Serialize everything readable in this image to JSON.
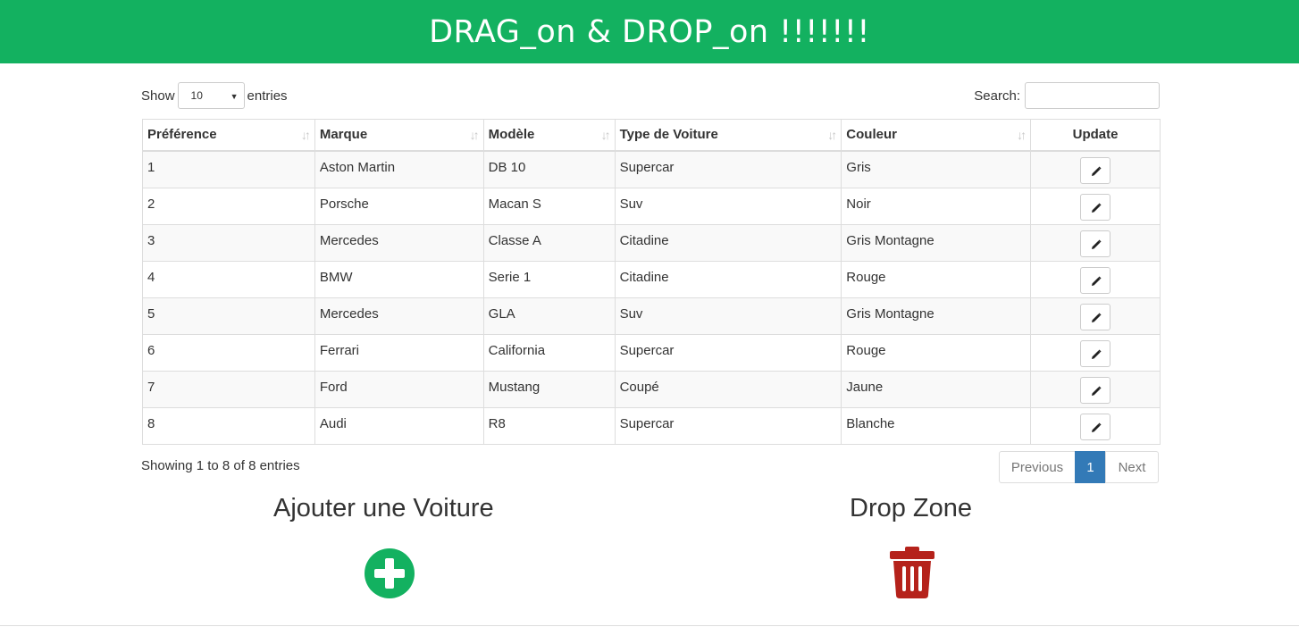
{
  "header": {
    "title": "DRAG_on & DROP_on !!!!!!!"
  },
  "length_menu": {
    "prefix": "Show",
    "value": "10",
    "suffix": "entries"
  },
  "search": {
    "label": "Search:",
    "value": ""
  },
  "table": {
    "columns": [
      "Préférence",
      "Marque",
      "Modèle",
      "Type de Voiture",
      "Couleur",
      "Update"
    ],
    "rows": [
      [
        "1",
        "Aston Martin",
        "DB 10",
        "Supercar",
        "Gris"
      ],
      [
        "2",
        "Porsche",
        "Macan S",
        "Suv",
        "Noir"
      ],
      [
        "3",
        "Mercedes",
        "Classe A",
        "Citadine",
        "Gris Montagne"
      ],
      [
        "4",
        "BMW",
        "Serie 1",
        "Citadine",
        "Rouge"
      ],
      [
        "5",
        "Mercedes",
        "GLA",
        "Suv",
        "Gris Montagne"
      ],
      [
        "6",
        "Ferrari",
        "California",
        "Supercar",
        "Rouge"
      ],
      [
        "7",
        "Ford",
        "Mustang",
        "Coupé",
        "Jaune"
      ],
      [
        "8",
        "Audi",
        "R8",
        "Supercar",
        "Blanche"
      ]
    ]
  },
  "info": "Showing 1 to 8 of 8 entries",
  "pagination": {
    "previous": "Previous",
    "current": "1",
    "next": "Next"
  },
  "add_section": {
    "title": "Ajouter une Voiture",
    "icon": "plus-circle-icon"
  },
  "drop_section": {
    "title": "Drop Zone",
    "icon": "trash-icon"
  },
  "colors": {
    "brand": "#13b160",
    "danger": "#b5221b",
    "active_page": "#337ab7"
  }
}
